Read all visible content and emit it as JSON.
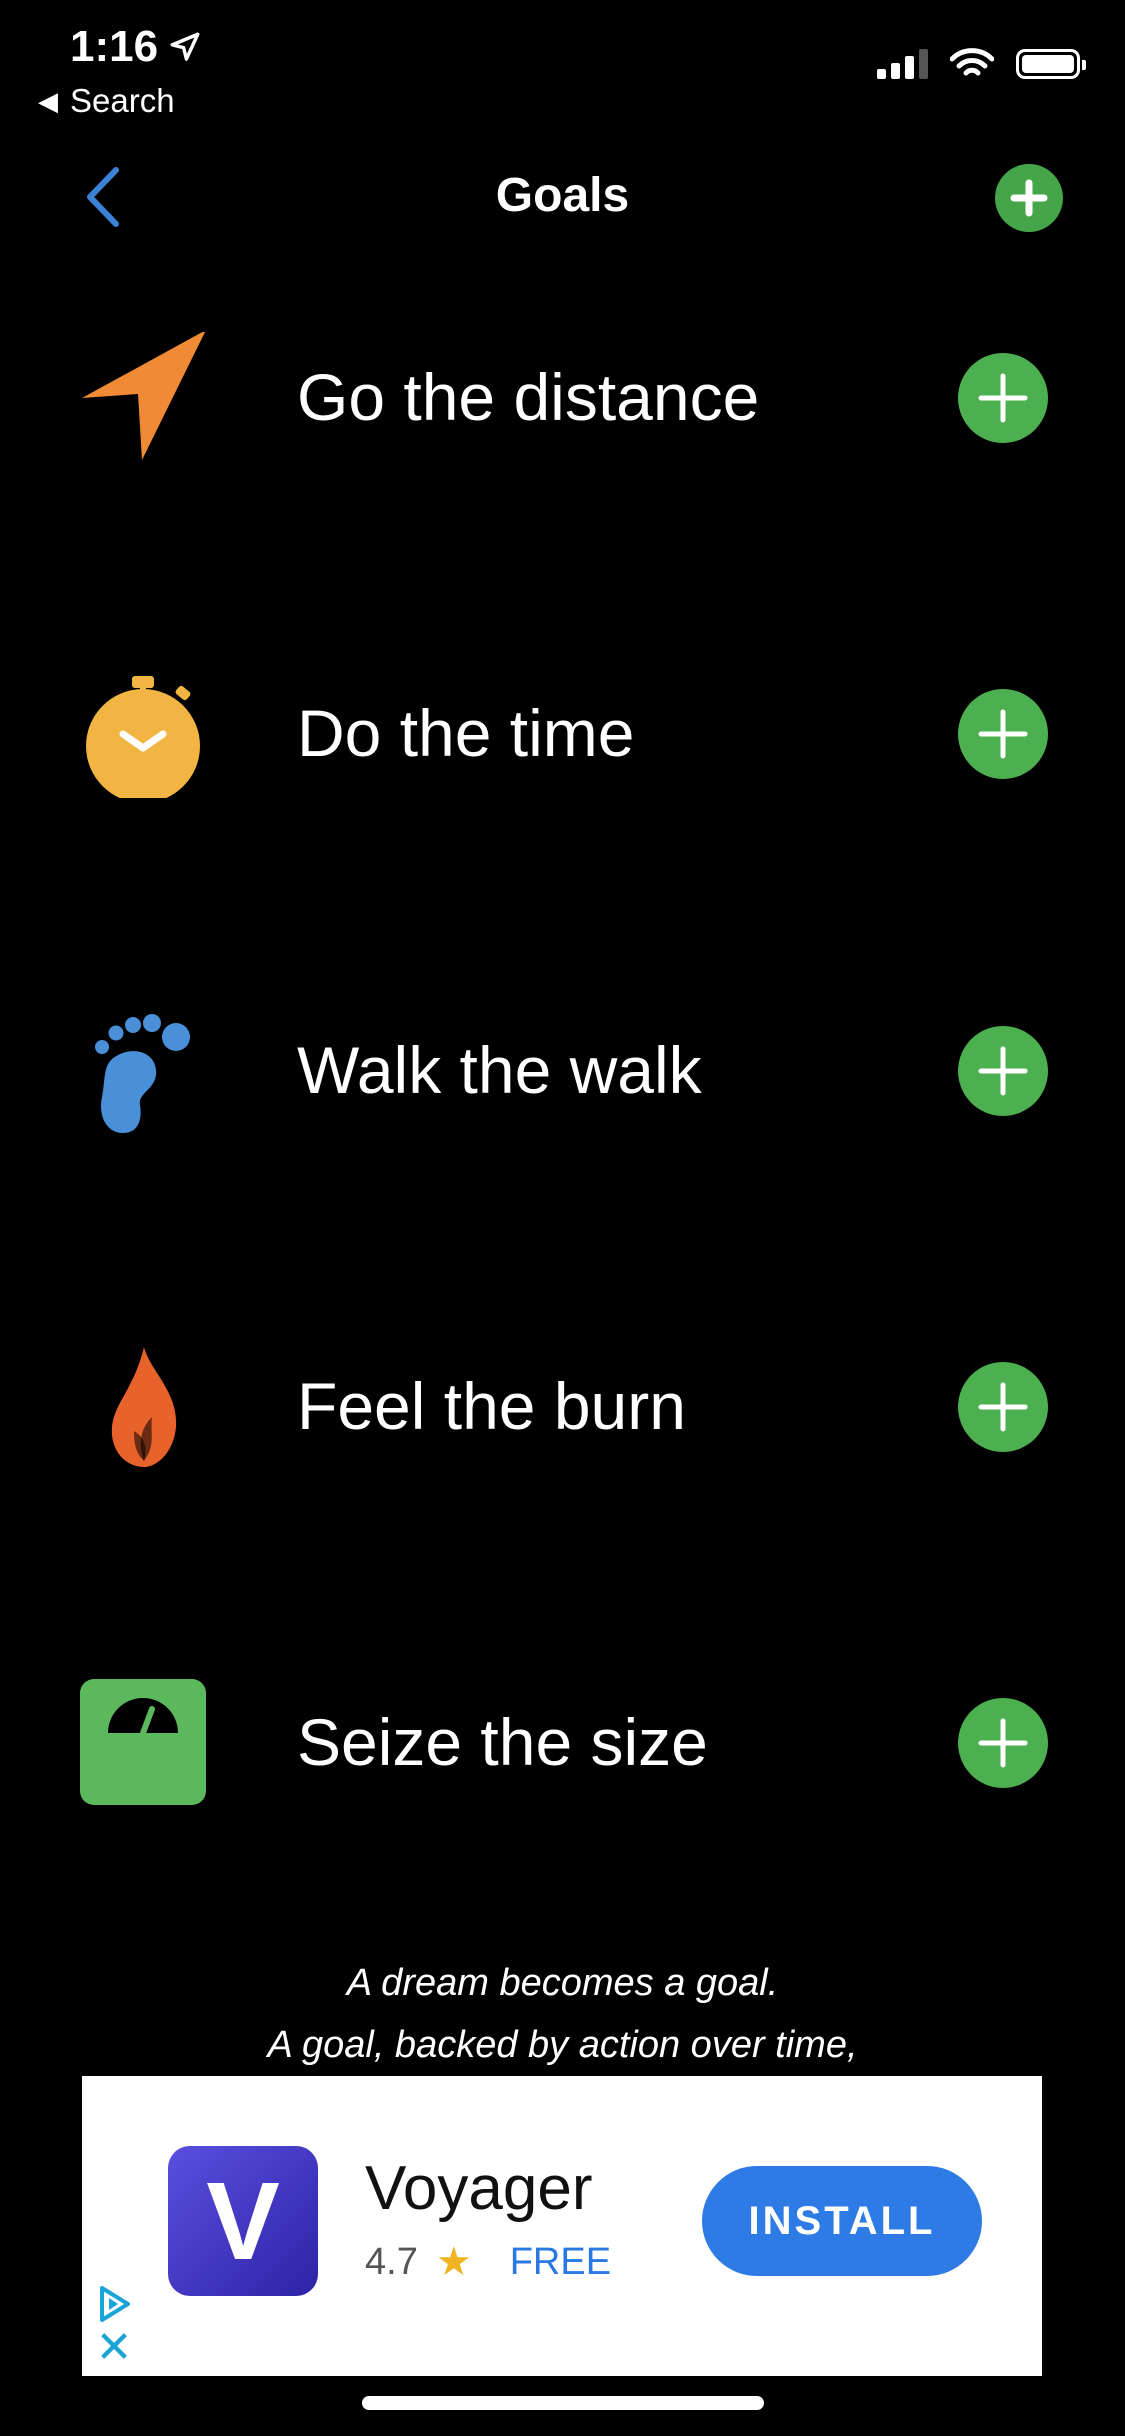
{
  "status_bar": {
    "time": "1:16",
    "back_label": "Search"
  },
  "nav": {
    "title": "Goals"
  },
  "goals": [
    {
      "label": "Go the distance",
      "icon": "navigation-arrow-icon"
    },
    {
      "label": "Do the time",
      "icon": "stopwatch-icon"
    },
    {
      "label": "Walk the walk",
      "icon": "footprint-icon"
    },
    {
      "label": "Feel the burn",
      "icon": "flame-icon"
    },
    {
      "label": "Seize the size",
      "icon": "scale-icon"
    }
  ],
  "quote": {
    "line1": "A dream becomes a goal.",
    "line2": "A goal, backed by action over time,"
  },
  "ad": {
    "app_letter": "V",
    "app_name": "Voyager",
    "rating": "4.7",
    "price": "FREE",
    "install_label": "INSTALL"
  },
  "colors": {
    "accent_green": "#4caf50",
    "back_blue": "#3b82d6",
    "distance_orange": "#f08a35",
    "timer_yellow": "#f2b544",
    "foot_blue": "#4a90d9",
    "flame_orange": "#e8632b",
    "scale_green": "#5cb85c"
  }
}
